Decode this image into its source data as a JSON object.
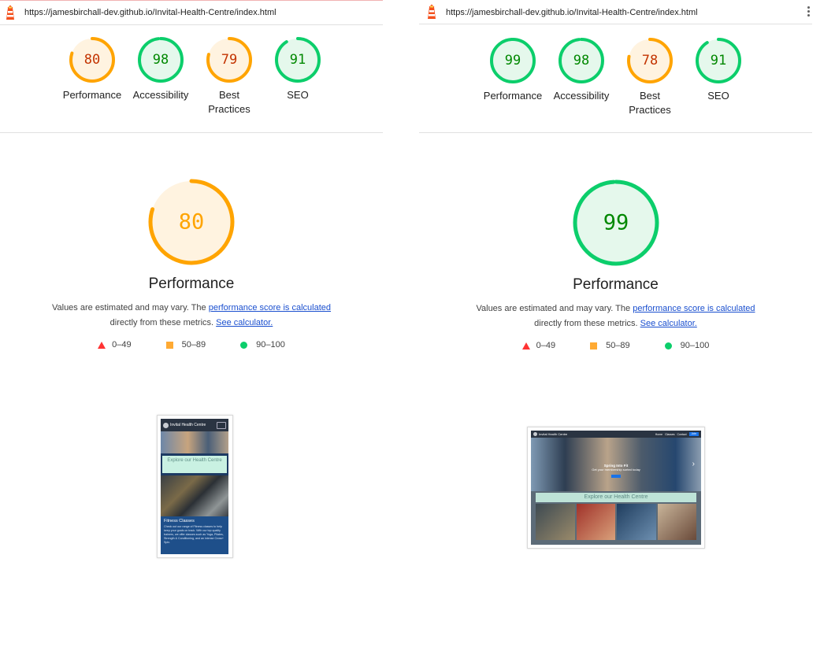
{
  "reports": [
    {
      "url": "https://jamesbirchall-dev.github.io/Invital-Health-Centre/index.html",
      "gauges": [
        {
          "label": "Performance",
          "score": 80,
          "color": "#ffa400",
          "text_color": "#c33300",
          "fill": "#fff3e0"
        },
        {
          "label": "Accessibility",
          "score": 98,
          "color": "#0cce6b",
          "text_color": "#008800",
          "fill": "#e5f8ec"
        },
        {
          "label": "Best Practices",
          "score": 79,
          "color": "#ffa400",
          "text_color": "#c33300",
          "fill": "#fff3e0"
        },
        {
          "label": "SEO",
          "score": 91,
          "color": "#0cce6b",
          "text_color": "#008800",
          "fill": "#e5f8ec"
        }
      ],
      "main": {
        "title": "Performance",
        "score": 80,
        "color": "#ffa400",
        "text_color": "#ffa400",
        "fill": "#fff3e0"
      },
      "screenshot": {
        "nav_title": "Invital Health Centre",
        "explore_text": "Explore our Health Centre",
        "section_title": "Fitness Classes",
        "section_text": "Check out our range of Fitness classes to help keep your goals on track. With our top quality trainers, we offer classes such as Yoga, Pilates, Strength & Conditioning, and an intense Cross+ Spin."
      }
    },
    {
      "url": "https://jamesbirchall-dev.github.io/Invital-Health-Centre/index.html",
      "gauges": [
        {
          "label": "Performance",
          "score": 99,
          "color": "#0cce6b",
          "text_color": "#008800",
          "fill": "#e5f8ec"
        },
        {
          "label": "Accessibility",
          "score": 98,
          "color": "#0cce6b",
          "text_color": "#008800",
          "fill": "#e5f8ec"
        },
        {
          "label": "Best Practices",
          "score": 78,
          "color": "#ffa400",
          "text_color": "#c33300",
          "fill": "#fff3e0"
        },
        {
          "label": "SEO",
          "score": 91,
          "color": "#0cce6b",
          "text_color": "#008800",
          "fill": "#e5f8ec"
        }
      ],
      "main": {
        "title": "Performance",
        "score": 99,
        "color": "#0cce6b",
        "text_color": "#008800",
        "fill": "#e5f8ec"
      },
      "screenshot": {
        "nav_title": "Invital Health Centre",
        "nav_links": [
          "Home",
          "Classes",
          "Contact",
          "Join"
        ],
        "hero_heading": "Spring Into Fit",
        "hero_sub": "Get your membership sorted today",
        "explore_text": "Explore our Health Centre"
      }
    }
  ],
  "description": {
    "before": "Values are estimated and may vary. The ",
    "link1": "performance score is calculated",
    "middle": "directly from these metrics. ",
    "link2": "See calculator."
  },
  "legend": [
    {
      "shape": "triangle",
      "range": "0–49",
      "color": "#ff3333"
    },
    {
      "shape": "square",
      "range": "50–89",
      "color": "#ffaa33"
    },
    {
      "shape": "circle",
      "range": "90–100",
      "color": "#0cce6b"
    }
  ],
  "icons": {
    "logo": "lighthouse-icon",
    "menu": "more-vert-icon"
  }
}
